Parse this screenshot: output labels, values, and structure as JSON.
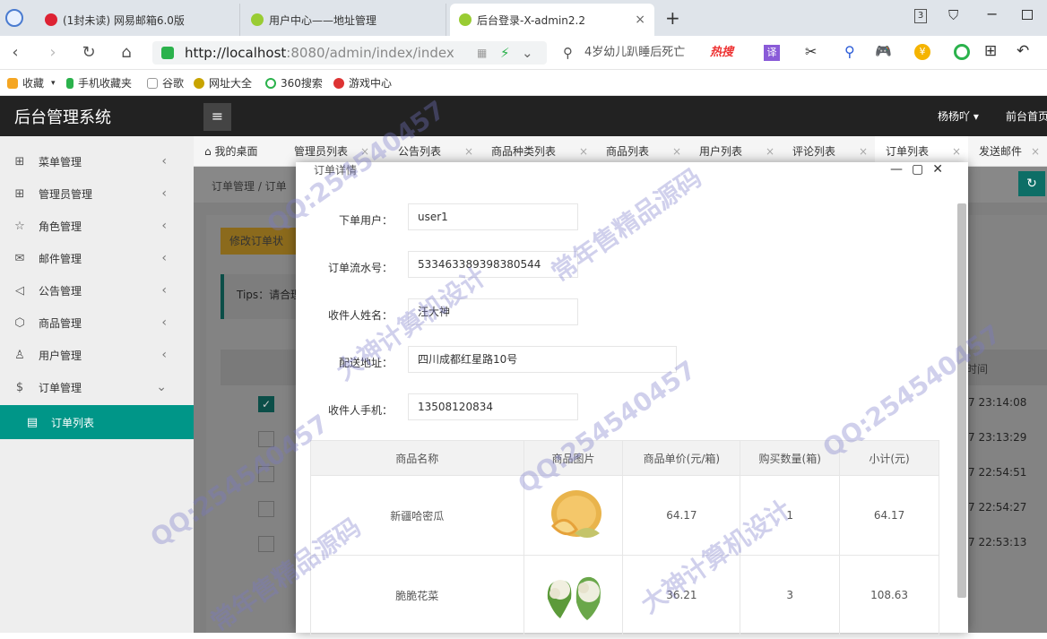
{
  "browser": {
    "tabs": [
      {
        "label": "(1封未读) 网易邮箱6.0版"
      },
      {
        "label": "用户中心——地址管理"
      },
      {
        "label": "后台登录-X-admin2.2"
      }
    ],
    "url_host": "http://localhost",
    "url_rest": ":8080/admin/index/index",
    "search": "4岁幼儿趴睡后死亡",
    "hot_badge": "热搜",
    "tab_count": "3",
    "bookmarks": [
      "收藏",
      "手机收藏夹",
      "谷歌",
      "网址大全",
      "360搜索",
      "游戏中心"
    ]
  },
  "app": {
    "title": "后台管理系统",
    "user": "杨杨吖",
    "front_link": "前台首页"
  },
  "sidebar": {
    "items": [
      {
        "label": "菜单管理",
        "icon": "grid-icon"
      },
      {
        "label": "管理员管理",
        "icon": "grid-icon"
      },
      {
        "label": "角色管理",
        "icon": "star-icon"
      },
      {
        "label": "邮件管理",
        "icon": "mail-icon"
      },
      {
        "label": "公告管理",
        "icon": "speaker-icon"
      },
      {
        "label": "商品管理",
        "icon": "box-icon"
      },
      {
        "label": "用户管理",
        "icon": "user-icon"
      },
      {
        "label": "订单管理",
        "icon": "dollar-icon"
      }
    ],
    "sub_item": "订单列表"
  },
  "content_tabs": [
    "我的桌面",
    "管理员列表",
    "公告列表",
    "商品种类列表",
    "商品列表",
    "用户列表",
    "评论列表",
    "订单列表",
    "发送邮件"
  ],
  "background": {
    "breadcrumb": "订单管理 / 订单",
    "edit_button": "修改订单状",
    "tips": "Tips：请合理",
    "time_header": "时间",
    "times": [
      "7 23:14:08",
      "7 23:13:29",
      "7 22:54:51",
      "7 22:54:27",
      "7 22:53:13"
    ]
  },
  "modal": {
    "title": "订单详情",
    "fields": [
      {
        "label": "下单用户：",
        "value": "user1"
      },
      {
        "label": "订单流水号：",
        "value": "533463389398380544"
      },
      {
        "label": "收件人姓名：",
        "value": "汪大神"
      },
      {
        "label": "配送地址：",
        "value": "四川成都红星路10号"
      },
      {
        "label": "收件人手机：",
        "value": "13508120834"
      }
    ],
    "table": {
      "headers": [
        "商品名称",
        "商品图片",
        "商品单价(元/箱)",
        "购买数量(箱)",
        "小计(元)"
      ],
      "rows": [
        {
          "name": "新疆哈密瓜",
          "image": "melon-image",
          "price": "64.17",
          "qty": "1",
          "subtotal": "64.17"
        },
        {
          "name": "脆脆花菜",
          "image": "cauliflower-image",
          "price": "36.21",
          "qty": "3",
          "subtotal": "108.63"
        }
      ]
    }
  },
  "watermarks": [
    "QQ:254540457",
    "大神计算机设计",
    "常年售精品源码"
  ]
}
